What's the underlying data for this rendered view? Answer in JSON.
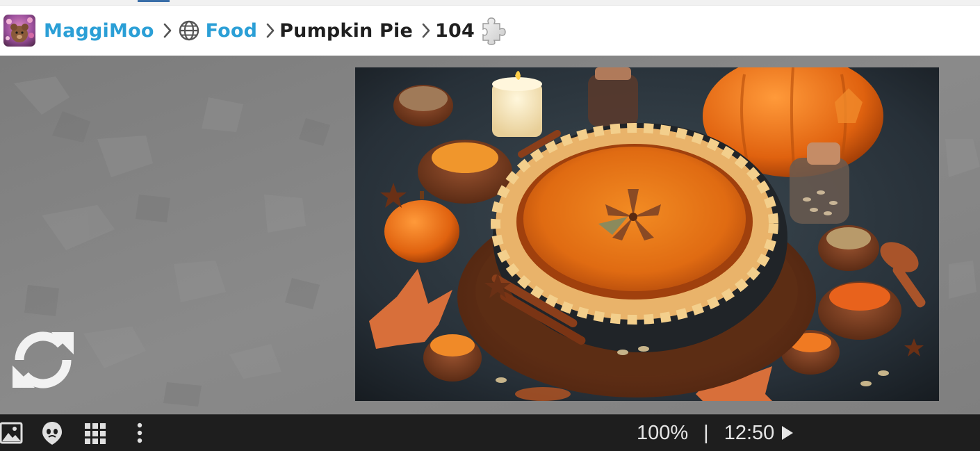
{
  "breadcrumb": {
    "user": "MaggiMoo",
    "category": "Food",
    "puzzle_title": "Pumpkin Pie",
    "piece_count": "104"
  },
  "icons": {
    "avatar": "avatar",
    "separator": "chevron-right-icon",
    "category": "globe-icon",
    "puzzle": "puzzle-piece-icon",
    "refresh": "refresh-icon",
    "image": "image-icon",
    "ghost": "ghost-icon",
    "grid": "grid-icon",
    "more": "more-vertical-icon",
    "play": "play-icon"
  },
  "status": {
    "zoom": "100%",
    "divider": "|",
    "timer": "12:50"
  },
  "colors": {
    "link": "#2b9fd6",
    "board": "#858585",
    "bottom_bar": "#1e1e1e"
  }
}
